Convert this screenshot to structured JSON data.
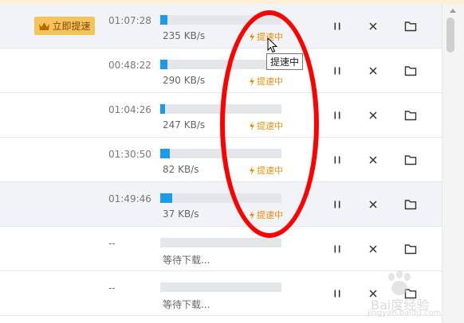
{
  "boost_button": {
    "label": "立即提速",
    "crown_icon": "crown-icon"
  },
  "tooltip": "提速中",
  "rows": [
    {
      "time": "01:07:28",
      "progress": 0.06,
      "speed": "235 KB/s",
      "accel": "提速中",
      "highlighted": true,
      "boost_button": true
    },
    {
      "time": "00:48:22",
      "progress": 0.06,
      "speed": "290 KB/s",
      "accel": "提速中",
      "highlighted": false,
      "boost_button": false
    },
    {
      "time": "01:04:26",
      "progress": 0.04,
      "speed": "247 KB/s",
      "accel": "提速中",
      "highlighted": false,
      "boost_button": false
    },
    {
      "time": "01:30:50",
      "progress": 0.08,
      "speed": "82 KB/s",
      "accel": "提速中",
      "highlighted": false,
      "boost_button": false
    },
    {
      "time": "01:49:46",
      "progress": 0.1,
      "speed": "37 KB/s",
      "accel": "提速中",
      "highlighted": true,
      "boost_button": false
    },
    {
      "time": "--",
      "progress": 0,
      "speed": "等待下载...",
      "accel": "",
      "highlighted": false,
      "boost_button": false
    },
    {
      "time": "--",
      "progress": 0,
      "speed": "等待下载...",
      "accel": "",
      "highlighted": false,
      "boost_button": false
    }
  ],
  "watermark": {
    "main": "Bai度经验",
    "sub": "jingyan.baidu.com"
  },
  "colors": {
    "progress_fill": "#1a9bf0",
    "accel_orange": "#e8900a",
    "boost_gold": "#f6c25a",
    "annotation_red": "#ff0000"
  }
}
